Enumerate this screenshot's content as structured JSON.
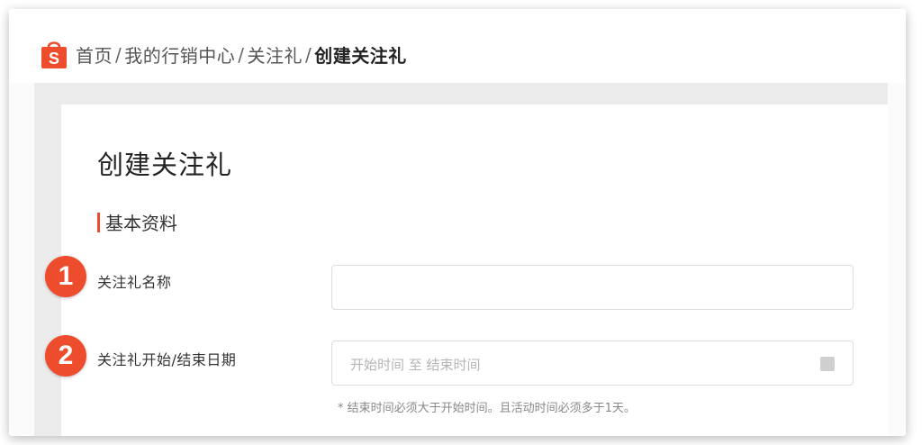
{
  "breadcrumb": {
    "home": "首页",
    "marketing": "我的行销中心",
    "follow_gift": "关注礼",
    "current": "创建关注礼",
    "separator": "/"
  },
  "page": {
    "title": "创建关注礼",
    "section_title": "基本资料"
  },
  "form": {
    "name": {
      "step": "1",
      "label": "关注礼名称",
      "value": ""
    },
    "period": {
      "step": "2",
      "label": "关注礼开始/结束日期",
      "placeholder": "开始时间 至 结束时间",
      "hint": "* 结束时间必须大于开始时间。且活动时间必须多于1天。"
    }
  },
  "colors": {
    "brand": "#ee4d2d",
    "icon_calendar": "calendar-icon",
    "icon_logo": "shopee-bag-logo-icon"
  }
}
